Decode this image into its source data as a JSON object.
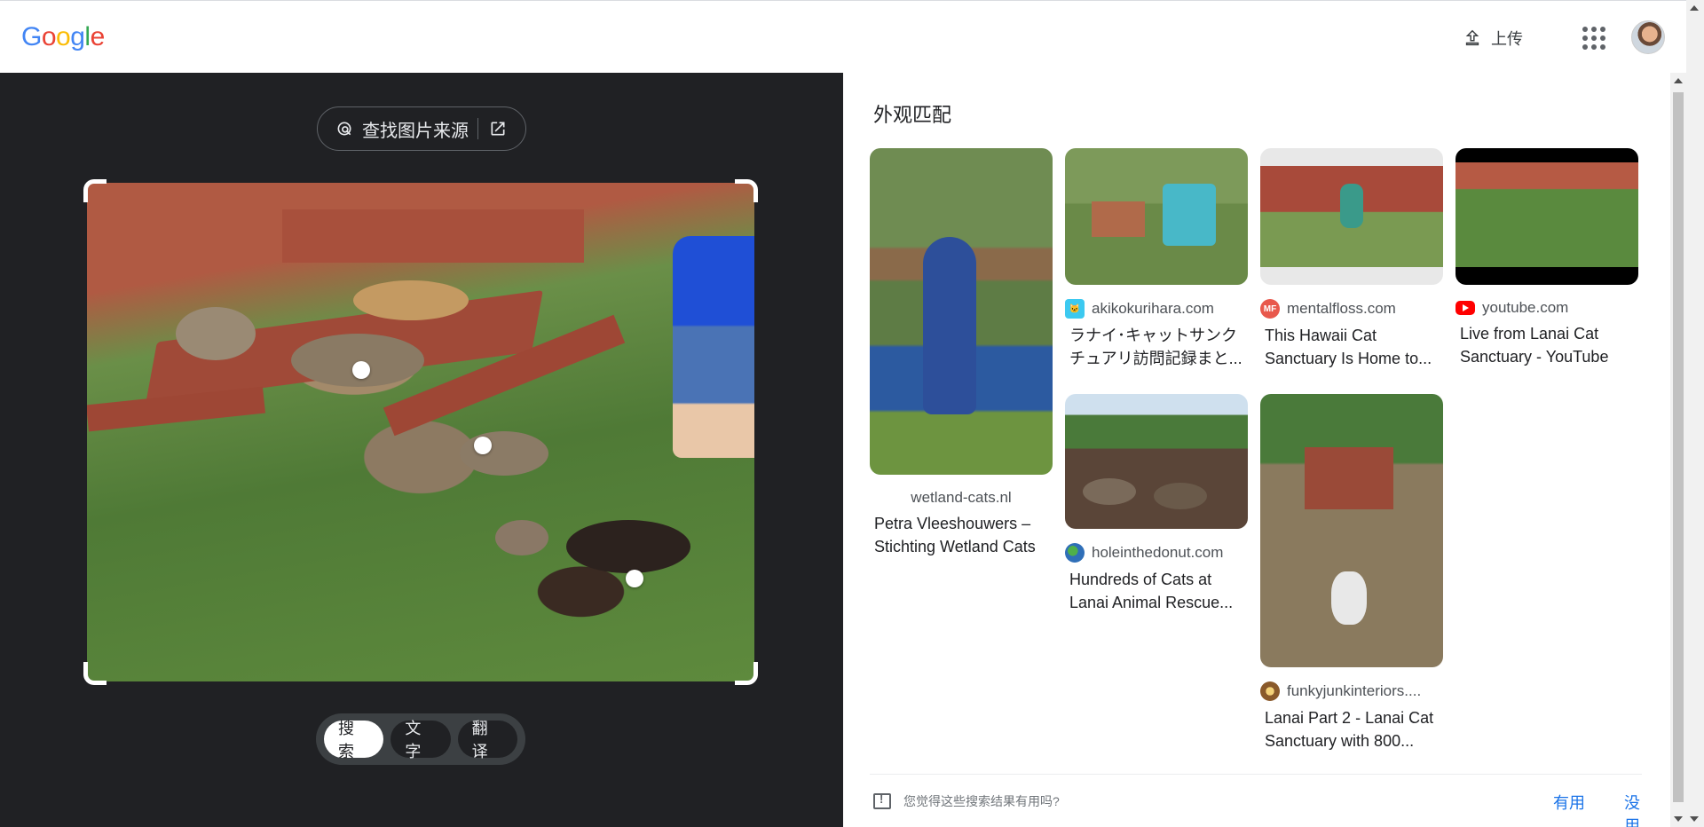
{
  "header": {
    "logo_letters": [
      {
        "char": "G",
        "color": "#4285f4"
      },
      {
        "char": "o",
        "color": "#ea4335"
      },
      {
        "char": "o",
        "color": "#fbbc05"
      },
      {
        "char": "g",
        "color": "#4285f4"
      },
      {
        "char": "l",
        "color": "#34a853"
      },
      {
        "char": "e",
        "color": "#ea4335"
      }
    ],
    "upload_label": "上传",
    "upload_icon": "upload-icon",
    "apps_icon": "apps-grid-icon",
    "avatar_icon": "user-avatar"
  },
  "left": {
    "find_source_label": "查找图片来源",
    "mode_tabs": [
      {
        "label": "搜索",
        "active": true
      },
      {
        "label": "文字",
        "active": false
      },
      {
        "label": "翻译",
        "active": false
      }
    ]
  },
  "right": {
    "section_title": "外观匹配",
    "results": [
      {
        "source": "wetland-cats.nl",
        "title": "Petra Vleeshouwers – Stichting Wetland Cats",
        "favicon": "none",
        "favicon_color": "#ffffff"
      },
      {
        "source": "akikokurihara.com",
        "title": "ラナイ･キャットサンクチュアリ訪問記録まと...",
        "favicon": "cat-icon",
        "favicon_color": "#3cc9f0"
      },
      {
        "source": "mentalfloss.com",
        "title": "This Hawaii Cat Sanctuary Is Home to...",
        "favicon": "MF",
        "favicon_color": "#e8584c"
      },
      {
        "source": "youtube.com",
        "title": "Live from Lanai Cat Sanctuary - YouTube",
        "favicon": "youtube-icon",
        "favicon_color": "#ff0000"
      },
      {
        "source": "holeinthedonut.com",
        "title": "Hundreds of Cats at Lanai Animal Rescue...",
        "favicon": "globe-icon",
        "favicon_color": "#2f6fb8"
      },
      {
        "source": "funkyjunkinteriors....",
        "title": "Lanai Part 2 - Lanai Cat Sanctuary with 800...",
        "favicon": "sunburst-icon",
        "favicon_color": "#8a5a2b"
      }
    ],
    "feedback": {
      "question": "您觉得这些搜索结果有用吗?",
      "yes": "有用",
      "no": "没用"
    }
  }
}
